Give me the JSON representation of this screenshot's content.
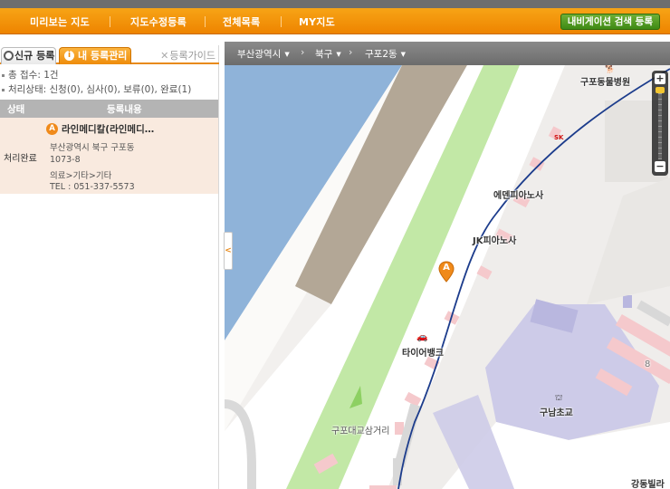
{
  "nav": {
    "items": [
      "미리보는 지도",
      "지도수정등록",
      "전체목록",
      "MY지도"
    ],
    "button": "내비게이션 검색 등록"
  },
  "tabs": {
    "new": "신규 등록",
    "mine": "내 등록관리",
    "guide": "등록가이드",
    "guide_prefix": "✕"
  },
  "summary": {
    "total": "총 접수: 1건",
    "status": "처리상태: 신청(0), 심사(0), 보류(0), 완료(1)"
  },
  "table": {
    "headers": [
      "상태",
      "등록내용"
    ],
    "rows": [
      {
        "status": "처리완료",
        "marker": "A",
        "name": "라인메디칼(라인메디…",
        "address1": "부산광역시 북구 구포동",
        "address2": "1073-8",
        "category": "의료>기타>기타",
        "tel": "TEL : 051-337-5573"
      }
    ]
  },
  "breadcrumb": [
    "부산광역시",
    "북구",
    "구포2동"
  ],
  "map": {
    "pin_label": "A",
    "labels": {
      "animal_hospital": "구포동물병원",
      "eden_piano": "에덴피아노사",
      "jk_piano": "JK피아노사",
      "tire_bank": "타이어뱅크",
      "bridge_street": "구포대교삼거리",
      "gunam_school": "구남초교",
      "gangdong_villa": "강동빌라",
      "sk": "SK",
      "block_number": "8"
    },
    "zoom": {
      "plus": "+",
      "minus": "−"
    }
  },
  "icons": {
    "collapse": "chevron-left-icon",
    "search_tab": "magnifier-icon",
    "info_tab": "info-icon"
  },
  "colors": {
    "nav_orange": "#ee8400",
    "water": "#8fb3d9",
    "park": "#c2e8a6",
    "boundary": "#1c3c8c",
    "school": "#cdcbe8",
    "pin": "#f08a1a"
  }
}
